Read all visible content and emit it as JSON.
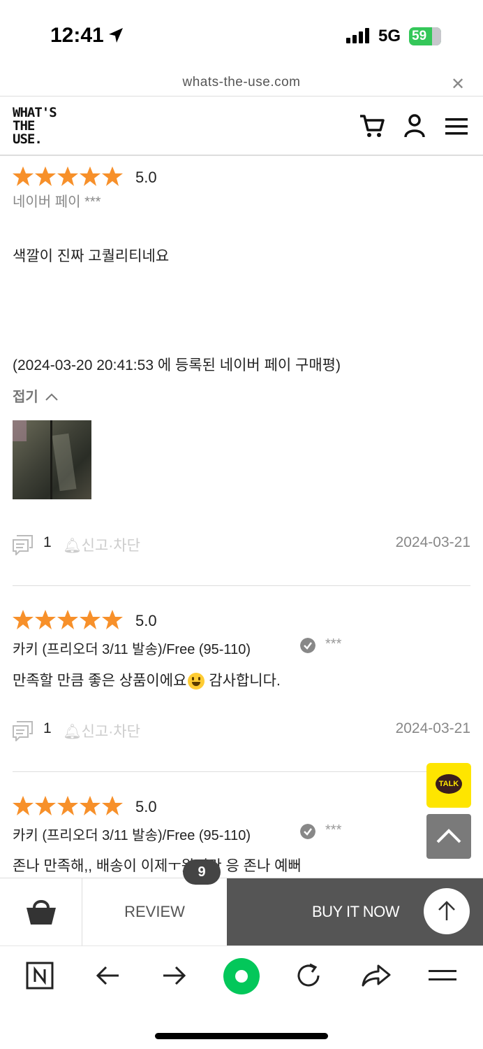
{
  "status": {
    "time": "12:41",
    "network": "5G",
    "battery": "59"
  },
  "url_bar": {
    "url": "whats-the-use.com"
  },
  "header": {
    "logo_lines": [
      "WHAT'S",
      "THE",
      "USE."
    ]
  },
  "reviews": [
    {
      "rating": "5.0",
      "stars": 5,
      "author": "네이버 페이 ***",
      "body": "색깔이 진짜 고퀄리티네요",
      "source_note": "(2024-03-20 20:41:53 에 등록된 네이버 페이 구매평)",
      "fold_label": "접기",
      "comments": "1",
      "report": "신고·차단",
      "date": "2024-03-21"
    },
    {
      "rating": "5.0",
      "stars": 5,
      "option": "카키 (프리오더 3/11 발송)/Free (95-110)",
      "author": "***",
      "body": "만족할 만큼 좋은 상품이에요",
      "body_suffix": "감사합니다.",
      "comments": "1",
      "report": "신고·차단",
      "date": "2024-03-21"
    },
    {
      "rating": "5.0",
      "stars": 5,
      "option": "카키 (프리오더 3/11 발송)/Free (95-110)",
      "author": "***",
      "body": "존나 만족해,, 배송이 이제ㅜ왔지만 응 존나 예뻐"
    }
  ],
  "floating": {
    "kakao_label": "TALK"
  },
  "bottom_bar": {
    "review_label": "REVIEW",
    "review_count": "9",
    "buy_label": "BUY IT NOW"
  },
  "colors": {
    "star": "#f7902a",
    "buy_bg": "#555555",
    "kakao": "#fee500",
    "naver_green": "#03c75a"
  }
}
